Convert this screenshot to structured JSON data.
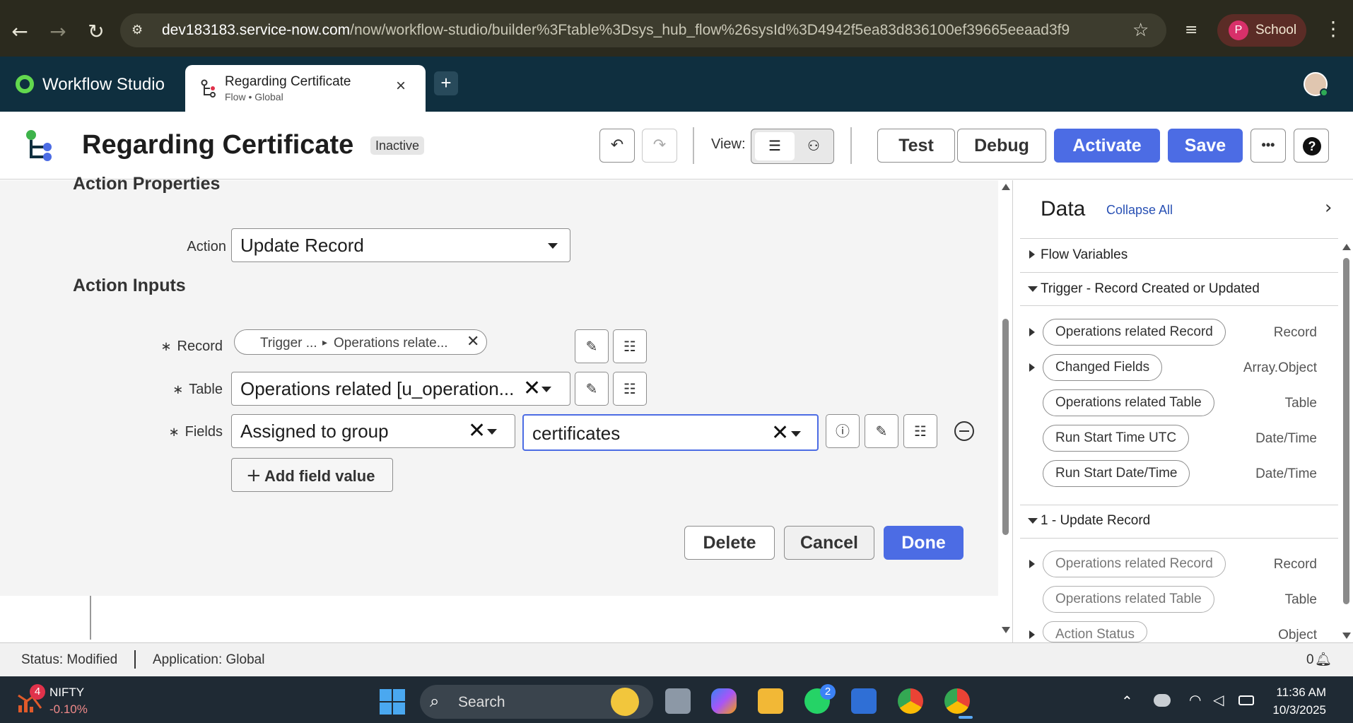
{
  "browser": {
    "url_host": "dev183183.service-now.com",
    "url_path": "/now/workflow-studio/builder%3Ftable%3Dsys_hub_flow%26sysId%3D4942f5ea83d836100ef39665eeaad3f9",
    "profile_initial": "P",
    "profile_name": "School"
  },
  "app": {
    "name": "Workflow Studio",
    "tab_title": "Regarding Certificate",
    "tab_subtitle": "Flow • Global",
    "add_tab": "+"
  },
  "flow": {
    "title": "Regarding Certificate",
    "status": "Inactive",
    "view_label": "View:",
    "buttons": {
      "test": "Test",
      "debug": "Debug",
      "activate": "Activate",
      "save": "Save",
      "more": "•••",
      "help": "?"
    }
  },
  "editor": {
    "action_properties": "Action Properties",
    "action_label": "Action",
    "action_value": "Update Record",
    "action_inputs": "Action Inputs",
    "record_label": "Record",
    "record_pill_part1": "Trigger ...",
    "record_pill_part2": "Operations relate...",
    "table_label": "Table",
    "table_value": "Operations related [u_operation...",
    "fields_label": "Fields",
    "field_name": "Assigned to group",
    "field_value": "certificates",
    "add_field": "Add field value",
    "delete": "Delete",
    "cancel": "Cancel",
    "done": "Done"
  },
  "data_panel": {
    "title": "Data",
    "collapse_all": "Collapse All",
    "flow_variables": "Flow Variables",
    "trigger_group": "Trigger - Record Created or Updated",
    "trigger_items": [
      {
        "name": "Operations related Record",
        "type": "Record"
      },
      {
        "name": "Changed Fields",
        "type": "Array.Object"
      },
      {
        "name": "Operations related Table",
        "type": "Table"
      },
      {
        "name": "Run Start Time UTC",
        "type": "Date/Time"
      },
      {
        "name": "Run Start Date/Time",
        "type": "Date/Time"
      }
    ],
    "update_group": "1 - Update Record",
    "update_items": [
      {
        "name": "Operations related Record",
        "type": "Record"
      },
      {
        "name": "Operations related Table",
        "type": "Table"
      },
      {
        "name": "Action Status",
        "type": "Object"
      }
    ]
  },
  "statusbar": {
    "status": "Status: Modified",
    "application": "Application: Global",
    "notifications": "0"
  },
  "taskbar": {
    "nifty_badge": "4",
    "nifty_name": "NIFTY",
    "nifty_change": "-0.10%",
    "search": "Search",
    "whatsapp_badge": "2",
    "time": "11:36 AM",
    "date": "10/3/2025"
  },
  "colors": {
    "accent_blue": "#4c6ce4",
    "header_navy": "#0f2f3f",
    "logo_green": "#62d84e"
  }
}
